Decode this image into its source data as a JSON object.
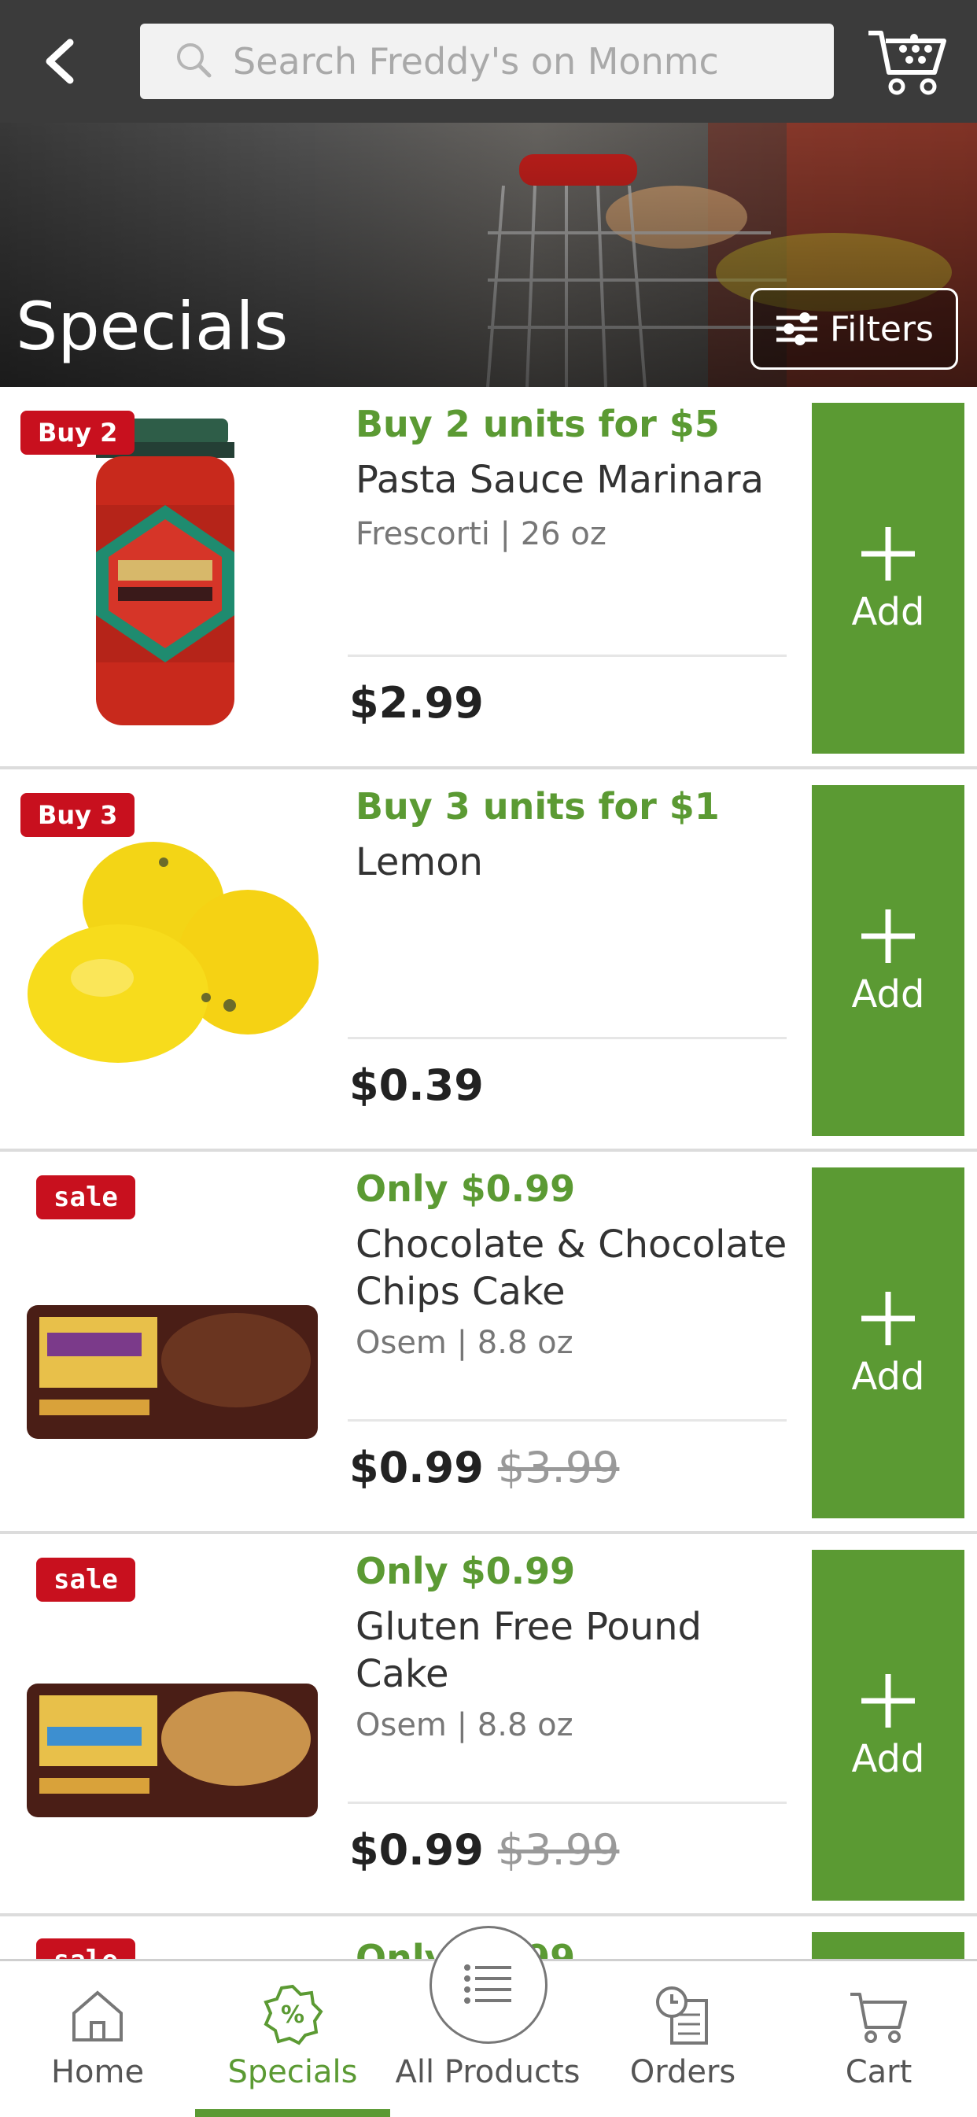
{
  "topbar": {
    "search_placeholder": "Search Freddy's on Monmc"
  },
  "hero": {
    "title": "Specials",
    "filters_label": "Filters"
  },
  "items": [
    {
      "badge": "Buy 2",
      "deal": "Buy 2 units for $5",
      "name": "Pasta Sauce Marinara",
      "meta": "Frescorti | 26 oz",
      "price": "$2.99",
      "was": "",
      "add": "Add"
    },
    {
      "badge": "Buy 3",
      "deal": "Buy 3 units for $1",
      "name": "Lemon",
      "meta": "",
      "price": "$0.39",
      "was": "",
      "add": "Add"
    },
    {
      "badge": "sale",
      "deal": "Only $0.99",
      "name": "Chocolate & Chocolate Chips Cake",
      "meta": "Osem | 8.8 oz",
      "price": "$0.99",
      "was": "$3.99",
      "add": "Add"
    },
    {
      "badge": "sale",
      "deal": "Only $0.99",
      "name": "Gluten Free Pound Cake",
      "meta": "Osem | 8.8 oz",
      "price": "$0.99",
      "was": "$3.99",
      "add": "Add"
    }
  ],
  "partial_item": {
    "badge": "sale",
    "deal": "Only $0.99"
  },
  "bottomnav": {
    "home": "Home",
    "specials": "Specials",
    "all_products": "All Products",
    "orders": "Orders",
    "cart": "Cart"
  },
  "colors": {
    "accent_green": "#5b9a33",
    "badge_red": "#c8101e",
    "topbar": "#3b3b3b"
  }
}
